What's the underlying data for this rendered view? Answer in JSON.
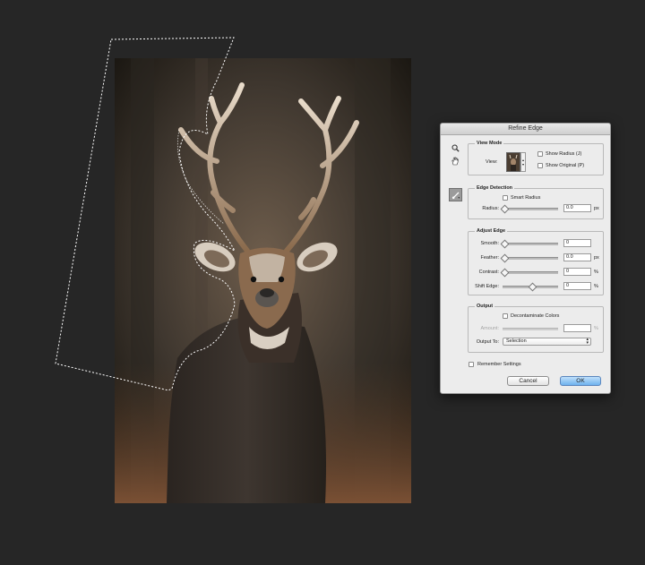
{
  "dialog": {
    "title": "Refine Edge",
    "view_mode": {
      "legend": "View Mode",
      "view_label": "View:",
      "show_radius": "Show Radius (J)",
      "show_original": "Show Original (P)"
    },
    "edge_detection": {
      "legend": "Edge Detection",
      "smart_radius": "Smart Radius",
      "radius_label": "Radius:",
      "radius_value": "0.0",
      "radius_unit": "px"
    },
    "adjust_edge": {
      "legend": "Adjust Edge",
      "smooth_label": "Smooth:",
      "smooth_value": "0",
      "feather_label": "Feather:",
      "feather_value": "0.0",
      "feather_unit": "px",
      "contrast_label": "Contrast:",
      "contrast_value": "0",
      "contrast_unit": "%",
      "shift_label": "Shift Edge:",
      "shift_value": "0",
      "shift_unit": "%"
    },
    "output": {
      "legend": "Output",
      "decontaminate": "Decontaminate Colors",
      "amount_label": "Amount:",
      "amount_value": "",
      "amount_unit": "%",
      "output_to_label": "Output To:",
      "output_to_value": "Selection"
    },
    "remember_settings": "Remember Settings",
    "cancel_label": "Cancel",
    "ok_label": "OK"
  },
  "colors": {
    "background": "#262626",
    "dialog_bg": "#ececec",
    "ok_button": "#6fb2ee",
    "selection_marquee": "#ffffff"
  },
  "icons": [
    "zoom-icon",
    "hand-icon",
    "refine-radius-brush-icon",
    "view-thumbnail-icon"
  ]
}
